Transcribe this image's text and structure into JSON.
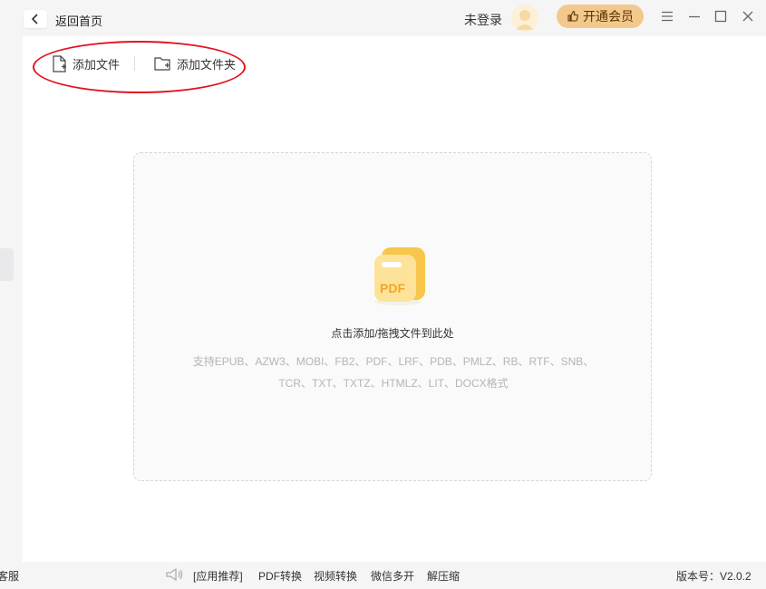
{
  "titlebar": {
    "back_label": "返回首页",
    "login_status": "未登录",
    "vip_button": "开通会员"
  },
  "toolbar": {
    "add_file": "添加文件",
    "add_folder": "添加文件夹"
  },
  "dropzone": {
    "title": "点击添加/拖拽文件到此处",
    "formats_line1": "支持EPUB、AZW3、MOBI、FB2、PDF、LRF、PDB、PMLZ、RB、RTF、SNB、",
    "formats_line2": "TCR、TXT、TXTZ、HTMLZ、LIT、DOCX格式",
    "icon_label": "PDF"
  },
  "footer": {
    "service": "客服",
    "app_recommend": "[应用推荐]",
    "links": [
      "PDF转换",
      "视频转换",
      "微信多开",
      "解压缩"
    ],
    "version": "版本号：V2.0.2"
  },
  "colors": {
    "accent": "#f3c88c",
    "annotation": "#e0141e",
    "pdf_icon": "#f7c64a"
  }
}
